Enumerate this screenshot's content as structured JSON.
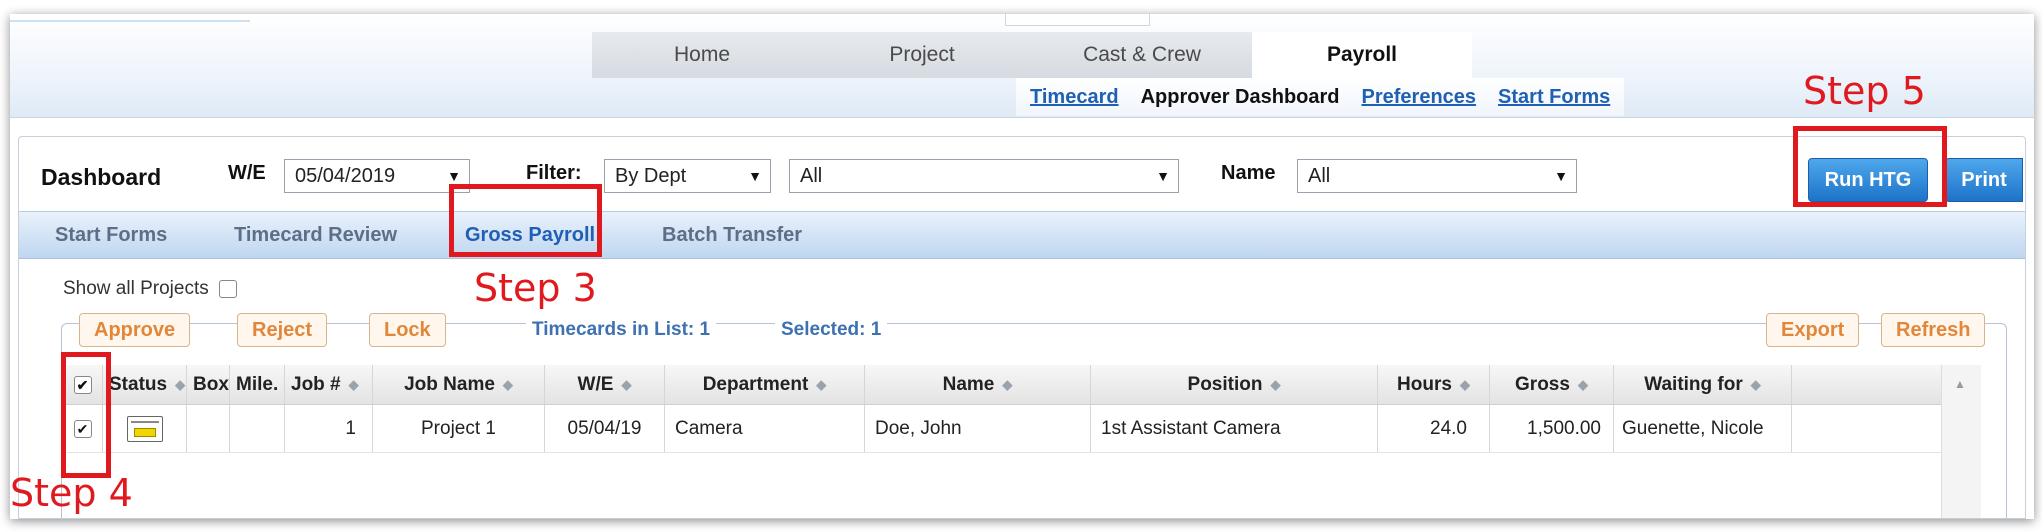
{
  "header": {
    "nav_tabs": [
      {
        "label": "Home",
        "active": false
      },
      {
        "label": "Project",
        "active": false
      },
      {
        "label": "Cast & Crew",
        "active": false
      },
      {
        "label": "Payroll",
        "active": true
      }
    ],
    "sub_links": {
      "timecard": "Timecard",
      "approver_dashboard": "Approver Dashboard",
      "preferences": "Preferences",
      "start_forms": "Start Forms"
    }
  },
  "filterbar": {
    "title": "Dashboard",
    "we_label": "W/E",
    "we_value": "05/04/2019",
    "filter_label": "Filter:",
    "filter_value": "By Dept",
    "dept_value": "All",
    "name_label": "Name",
    "name_value": "All",
    "run_htg": "Run HTG",
    "print": "Print"
  },
  "tabs": {
    "start_forms": "Start Forms",
    "timecard_review": "Timecard Review",
    "gross_payroll": "Gross Payroll",
    "batch_transfer": "Batch Transfer",
    "active": "Gross Payroll"
  },
  "show_all": {
    "label": "Show all Projects",
    "checked": false
  },
  "actions": {
    "approve": "Approve",
    "reject": "Reject",
    "lock": "Lock",
    "timecards_in_list": "Timecards in List: 1",
    "selected": "Selected: 1",
    "export": "Export",
    "refresh": "Refresh"
  },
  "grid": {
    "columns": [
      "Status",
      "Box",
      "Mile.",
      "Job #",
      "Job Name",
      "W/E",
      "Department",
      "Name",
      "Position",
      "Hours",
      "Gross",
      "Waiting for"
    ],
    "rows": [
      {
        "checked": true,
        "status_icon": "timecard-icon",
        "box": "",
        "mile": "",
        "job_no": "1",
        "job_name": "Project 1",
        "we": "05/04/19",
        "department": "Camera",
        "name": "Doe, John",
        "position": "1st Assistant Camera",
        "hours": "24.0",
        "gross": "1,500.00",
        "waiting_for": "Guenette, Nicole"
      }
    ]
  },
  "annotations": {
    "step3": "Step 3",
    "step4": "Step 4",
    "step5": "Step 5",
    "color": "#e0191f"
  }
}
